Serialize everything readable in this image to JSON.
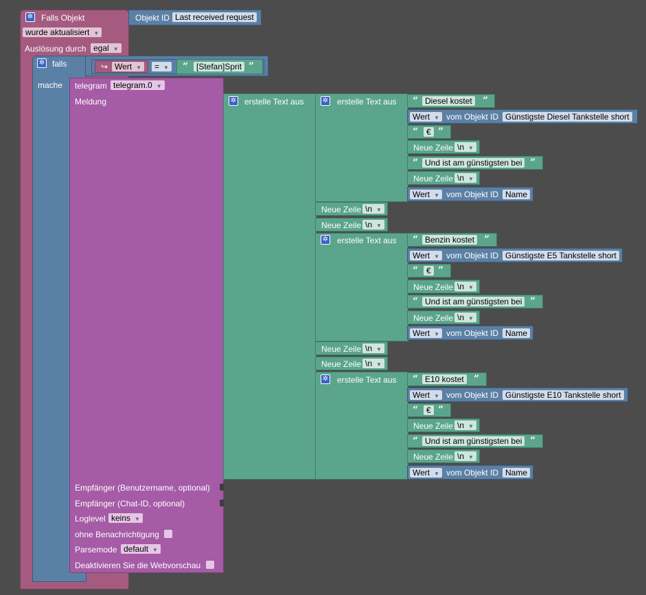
{
  "event": {
    "title": "Falls Objekt",
    "object_id_label": "Objekt ID",
    "object_id_value": "Last received request",
    "trigger": "wurde aktualisiert",
    "ausloesung_label": "Auslösung durch",
    "ausloesung_value": "egal"
  },
  "if_block": {
    "falls_label": "falls",
    "mache_label": "mache",
    "wert_label": "Wert",
    "operator": "=",
    "compare_value": "[Stefan]Sprit"
  },
  "telegram": {
    "instance_label": "telegram",
    "instance_value": "telegram.0",
    "meldung_label": "Meldung",
    "empfaenger_user_label": "Empfänger (Benutzername, optional)",
    "empfaenger_chat_label": "Empfänger (Chat-ID, optional)",
    "loglevel_label": "Loglevel",
    "loglevel_value": "keins",
    "ohne_benachrichtigung_label": "ohne Benachrichtigung",
    "parsemode_label": "Parsemode",
    "parsemode_value": "default",
    "webvorschau_label": "Deaktivieren Sie die Webvorschau"
  },
  "text_blocks": {
    "outer_label": "erstelle Text aus",
    "inner_label": "erstelle Text aus",
    "neue_zeile_label": "Neue Zeile",
    "newline_value": "\\n",
    "wert_label": "Wert",
    "vom_objekt_label": "vom Objekt ID",
    "euro": "€",
    "guenstigsten_text": "Und ist am günstigsten bei",
    "name_value": "Name",
    "diesel": {
      "kostet": "Diesel kostet",
      "object_id": "Günstigste Diesel Tankstelle short"
    },
    "benzin": {
      "kostet": "Benzin kostet",
      "object_id": "Günstigste E5 Tankstelle short"
    },
    "e10": {
      "kostet": "E10 kostet",
      "object_id": "Günstigste E10 Tankstelle short"
    }
  },
  "colors": {
    "background": "#4c4c4c",
    "event_block": "#a55b80",
    "logic_block": "#5b80a5",
    "telegram_block": "#a55ba5",
    "text_block": "#5ba58c",
    "gear_icon": "#3a63c7"
  },
  "icons": [
    "gear-icon",
    "dropdown-arrow-icon",
    "quote-open-icon",
    "quote-close-icon",
    "return-arrow-icon"
  ]
}
